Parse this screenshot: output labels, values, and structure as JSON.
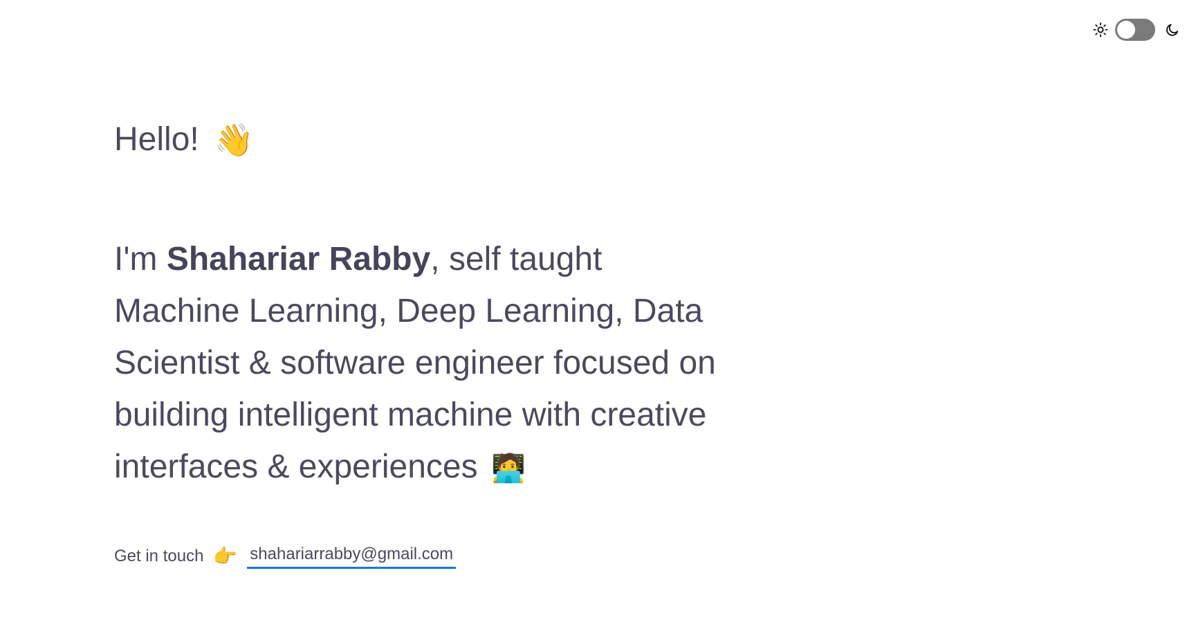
{
  "header": {
    "theme_toggle": {
      "sun_icon": "sun-icon",
      "moon_icon": "moon-icon",
      "state": "off",
      "track_color": "#7a7a7a"
    }
  },
  "hero": {
    "greeting": "Hello!",
    "greeting_emoji": "👋",
    "intro_prefix": "I'm ",
    "name": "Shahariar Rabby",
    "intro_text": ", self taught Machine Learning, Deep Learning, Data Scientist & software engineer focused on building intelligent machine with creative interfaces & experiences",
    "intro_emoji": "🧑‍💻"
  },
  "contact": {
    "label": "Get in touch",
    "emoji": "👉",
    "email": "shahariarrabby@gmail.com",
    "underline_color": "#1a73e8"
  },
  "colors": {
    "text": "#4a4a5e",
    "background": "#ffffff"
  }
}
